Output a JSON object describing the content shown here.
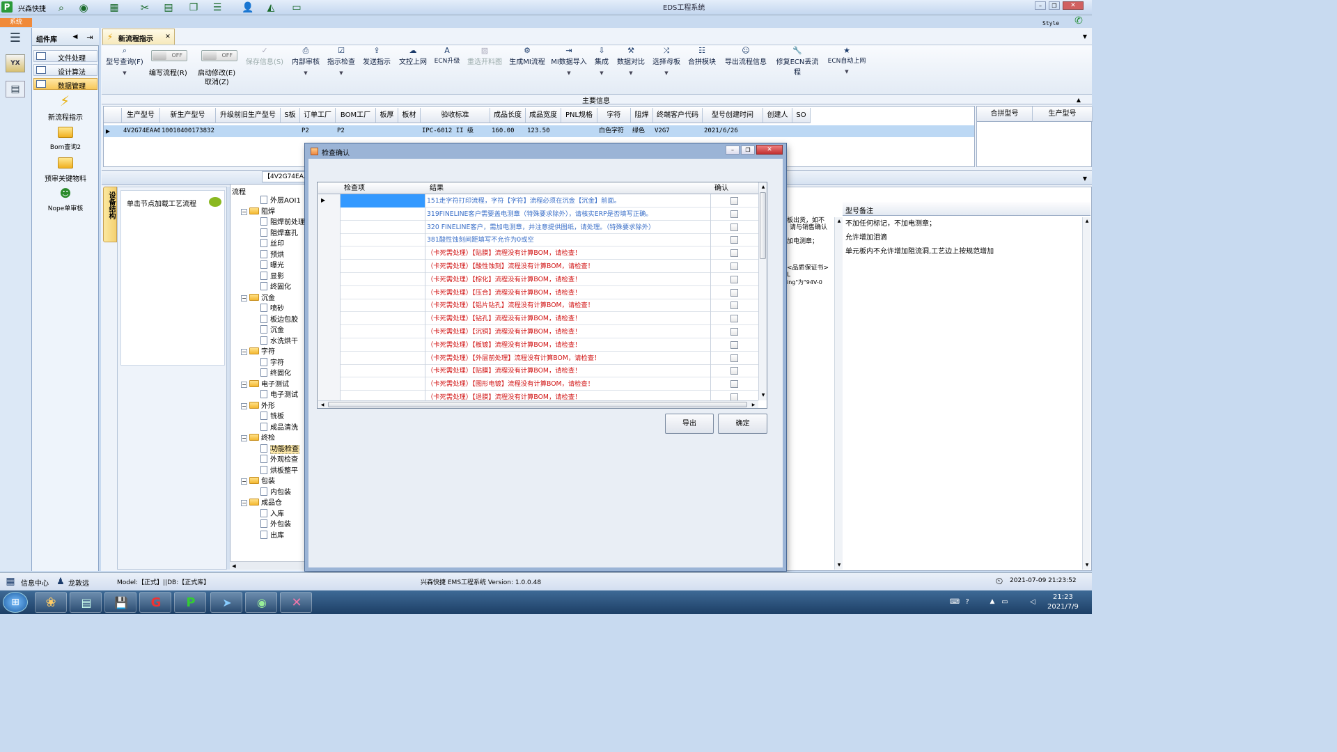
{
  "app": {
    "left_title": "兴森快捷",
    "window_title": "EDS工程系统",
    "system_tab": "系统",
    "style_label": "Style"
  },
  "sidebar_panel": {
    "header": "组件库",
    "items": [
      "文件处理",
      "设计算法",
      "数据管理"
    ],
    "tools": [
      "新流程指示",
      "Bom查询2",
      "预审关键物料",
      "Nope单审核"
    ]
  },
  "doc_tab": {
    "label": "新流程指示"
  },
  "toolbar": {
    "query": "型号查询(F)",
    "toggle_off": "OFF",
    "write_flow": "编写流程(R)",
    "start_edit": "启动修改(E)",
    "cancel": "取消(Z)",
    "buttons": [
      "保存信息(S)",
      "内部审核",
      "指示检查",
      "发送指示",
      "文控上网",
      "ECN升级",
      "重选开料图",
      "生成MI流程",
      "MI数据导入",
      "集成",
      "数据对比",
      "选择母板",
      "合拼模块",
      "导出流程信息",
      "修复ECN丢流程",
      "ECN自动上网"
    ]
  },
  "main_info": {
    "section_title": "主要信息",
    "columns": [
      "生产型号",
      "新生产型号",
      "升级前旧生产型号",
      "S板",
      "订单工厂",
      "BOM工厂",
      "板厚",
      "板材",
      "验收标准",
      "成品长度",
      "成品宽度",
      "PNL规格",
      "字符",
      "阻焊",
      "终端客户代码",
      "型号创建时间",
      "创建人",
      "SO"
    ],
    "row": [
      "4V2G74EAA0",
      "10010400173832",
      "",
      "",
      "P2",
      "P2",
      "",
      "",
      "IPC-6012 II 级",
      "160.00",
      "123.50",
      "",
      "白色字符",
      "绿色",
      "V2G7",
      "2021/6/26",
      "",
      ""
    ],
    "right_columns": [
      "合拼型号",
      "生产型号"
    ]
  },
  "lower_panel": {
    "tab_label": "【4V2G74EAA",
    "vertical_tab": "设备结构",
    "click_hint": "单击节点加载工艺流程",
    "flow_header": "流程"
  },
  "tree": [
    {
      "label": "外层AOI1",
      "type": "doc"
    },
    {
      "label": "阻焊",
      "type": "folder"
    },
    {
      "label": "阻焊前处理",
      "type": "doc"
    },
    {
      "label": "阻焊塞孔",
      "type": "doc"
    },
    {
      "label": "丝印",
      "type": "doc"
    },
    {
      "label": "预烘",
      "type": "doc"
    },
    {
      "label": "曝光",
      "type": "doc"
    },
    {
      "label": "显影",
      "type": "doc"
    },
    {
      "label": "终固化",
      "type": "doc"
    },
    {
      "label": "沉金",
      "type": "folder"
    },
    {
      "label": "喷砂",
      "type": "doc"
    },
    {
      "label": "板边包胶",
      "type": "doc"
    },
    {
      "label": "沉金",
      "type": "doc"
    },
    {
      "label": "水洗烘干",
      "type": "doc"
    },
    {
      "label": "字符",
      "type": "folder"
    },
    {
      "label": "字符",
      "type": "doc"
    },
    {
      "label": "终固化",
      "type": "doc"
    },
    {
      "label": "电子测试",
      "type": "folder"
    },
    {
      "label": "电子测试",
      "type": "doc"
    },
    {
      "label": "外形",
      "type": "folder"
    },
    {
      "label": "铣板",
      "type": "doc"
    },
    {
      "label": "成品清洗",
      "type": "doc"
    },
    {
      "label": "终检",
      "type": "folder"
    },
    {
      "label": "功能检查",
      "type": "doc"
    },
    {
      "label": "外观检查",
      "type": "doc"
    },
    {
      "label": "烘板整平",
      "type": "doc"
    },
    {
      "label": "包装",
      "type": "folder"
    },
    {
      "label": "内包装",
      "type": "doc"
    },
    {
      "label": "成品仓",
      "type": "folder"
    },
    {
      "label": "入库",
      "type": "doc"
    },
    {
      "label": "外包装",
      "type": "doc"
    },
    {
      "label": "出库",
      "type": "doc"
    }
  ],
  "right_notes": {
    "partial_lines": [
      "板出货，如不",
      "请与销售确认",
      "加电测章；",
      "<品质保证书>",
      "L",
      "ing\"为\"94V-0"
    ],
    "remark_header": "型号备注",
    "remarks": [
      "不加任何标记，不加电测章；",
      "允许增加泪滴",
      "单元板内不允许增加阻流洞,工艺边上按规范增加"
    ]
  },
  "dialog": {
    "title": "检查确认",
    "columns": [
      "检查项",
      "结果",
      "确认"
    ],
    "rows": [
      {
        "text": "151走字符打印流程，字符【字符】流程必须在沉金【沉金】前面。",
        "color": "#3a6fc8"
      },
      {
        "text": "319FINELINE客户需要盖电测章（特殊要求除外），请核实ERP是否填写正确。",
        "color": "#3a6fc8"
      },
      {
        "text": "320 FINELINE客户，需加电测章，并注意提供图纸，请处理。（特殊要求除外）",
        "color": "#3a6fc8"
      },
      {
        "text": "381酸性蚀刻间距填写不允许为0或空",
        "color": "#3a6fc8"
      },
      {
        "text": "（卡死需处理）【贴膜】流程没有计算BOM，请检查！",
        "color": "#d01010"
      },
      {
        "text": "（卡死需处理）【酸性蚀刻】流程没有计算BOM，请检查！",
        "color": "#d01010"
      },
      {
        "text": "（卡死需处理）【棕化】流程没有计算BOM，请检查！",
        "color": "#d01010"
      },
      {
        "text": "（卡死需处理）【压合】流程没有计算BOM，请检查！",
        "color": "#d01010"
      },
      {
        "text": "（卡死需处理）【铝片钻孔】流程没有计算BOM，请检查！",
        "color": "#d01010"
      },
      {
        "text": "（卡死需处理）【钻孔】流程没有计算BOM，请检查！",
        "color": "#d01010"
      },
      {
        "text": "（卡死需处理）【沉铜】流程没有计算BOM，请检查！",
        "color": "#d01010"
      },
      {
        "text": "（卡死需处理）【板镀】流程没有计算BOM，请检查！",
        "color": "#d01010"
      },
      {
        "text": "（卡死需处理）【外层前处理】流程没有计算BOM，请检查！",
        "color": "#d01010"
      },
      {
        "text": "（卡死需处理）【贴膜】流程没有计算BOM，请检查！",
        "color": "#d01010"
      },
      {
        "text": "（卡死需处理）【图形电镀】流程没有计算BOM，请检查！",
        "color": "#d01010"
      },
      {
        "text": "（卡死需处理）【退膜】流程没有计算BOM，请检查！",
        "color": "#d01010"
      }
    ],
    "export_button": "导出",
    "ok_button": "确定"
  },
  "statusbar": {
    "info_center": "信息中心",
    "user": "龙敦远",
    "model": "Model:【正式】||DB:【正式库】",
    "version": "兴森快捷 EMS工程系统 Version: 1.0.0.48",
    "datetime": "2021-07-09 21:23:52"
  },
  "taskbar": {
    "time": "21:23",
    "date": "2021/7/9"
  },
  "colors": {
    "selection": "#bcd8f4",
    "info_blue": "#3a6fc8",
    "error_red": "#d01010",
    "accent_orange": "#f08a3a"
  }
}
